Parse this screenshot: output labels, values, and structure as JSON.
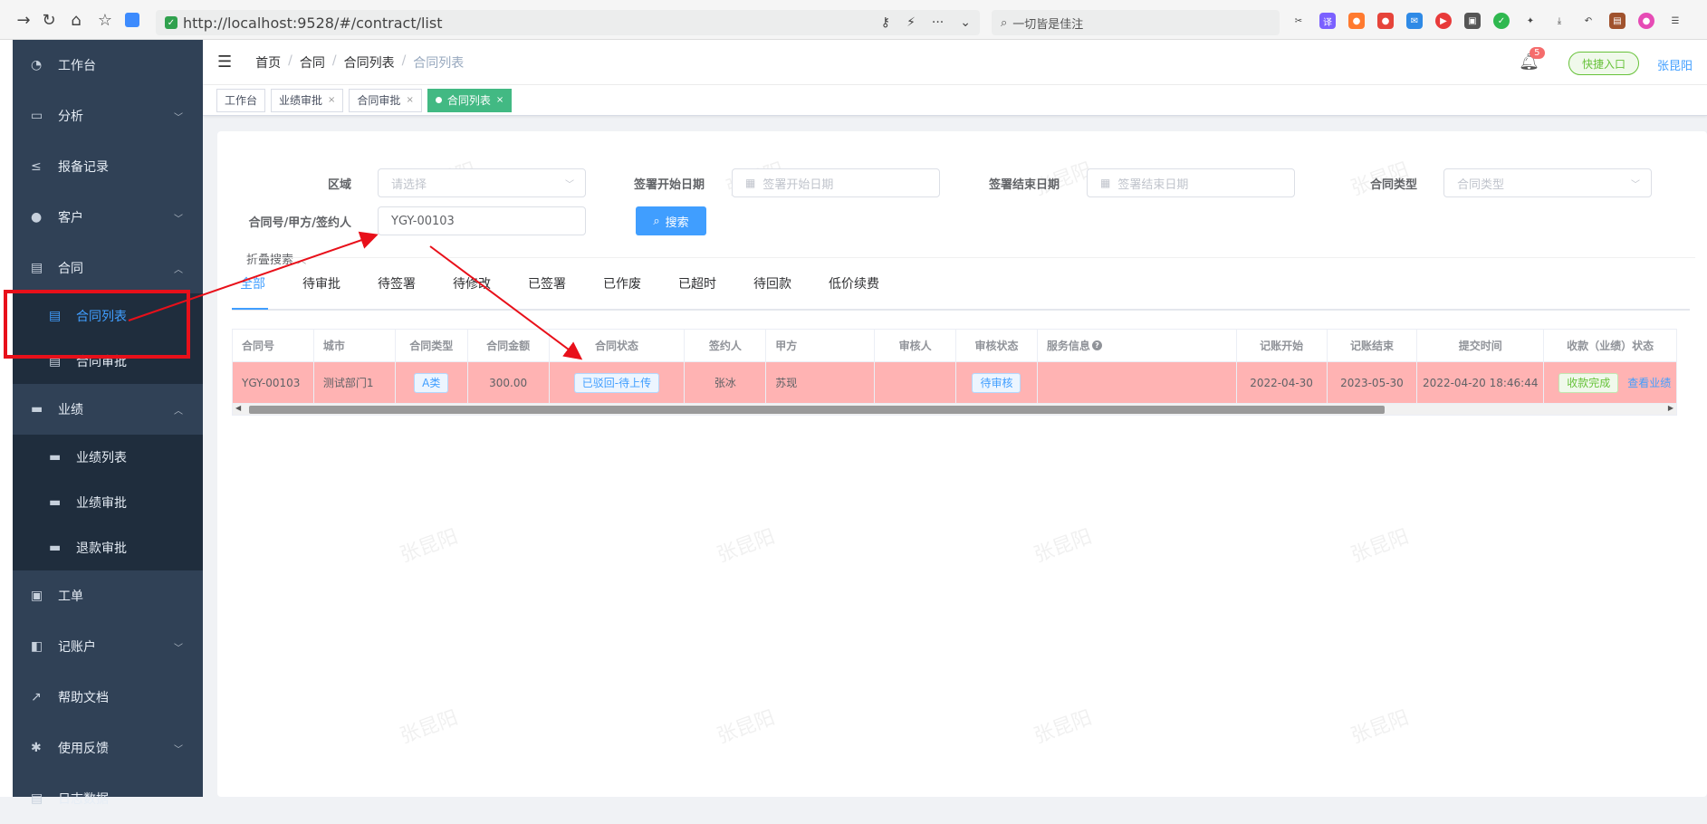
{
  "browser": {
    "url": "http://localhost:9528/#/contract/list",
    "search_placeholder": "一切皆是佳注"
  },
  "sidebar": {
    "items": [
      {
        "label": "工作台",
        "icon": "dashboard-icon"
      },
      {
        "label": "分析",
        "icon": "chart-icon"
      },
      {
        "label": "报备记录",
        "icon": "report-icon"
      },
      {
        "label": "客户",
        "icon": "user-icon"
      },
      {
        "label": "合同",
        "icon": "document-icon"
      },
      {
        "label": "合同列表",
        "icon": "document-icon"
      },
      {
        "label": "合同审批",
        "icon": "document-icon"
      },
      {
        "label": "业绩",
        "icon": "briefcase-icon"
      },
      {
        "label": "业绩列表",
        "icon": "briefcase-icon"
      },
      {
        "label": "业绩审批",
        "icon": "briefcase-icon"
      },
      {
        "label": "退款审批",
        "icon": "briefcase-icon"
      },
      {
        "label": "工单",
        "icon": "clipboard-icon"
      },
      {
        "label": "记账户",
        "icon": "book-icon"
      },
      {
        "label": "帮助文档",
        "icon": "external-link-icon"
      },
      {
        "label": "使用反馈",
        "icon": "bug-icon"
      },
      {
        "label": "日志数据",
        "icon": "document-icon"
      }
    ]
  },
  "header": {
    "breadcrumb": [
      "首页",
      "合同",
      "合同列表",
      "合同列表"
    ],
    "breadcrumb_sep": "/",
    "notification_count": "5",
    "quick_entry": "快捷入口",
    "user_name": "张昆阳"
  },
  "tags": [
    {
      "label": "工作台"
    },
    {
      "label": "业绩审批"
    },
    {
      "label": "合同审批"
    },
    {
      "label": "合同列表"
    }
  ],
  "filters": {
    "region_label": "区域",
    "region_placeholder": "请选择",
    "sign_start_label": "签署开始日期",
    "sign_start_placeholder": "签署开始日期",
    "sign_end_label": "签署结束日期",
    "sign_end_placeholder": "签署结束日期",
    "type_label": "合同类型",
    "type_placeholder": "合同类型",
    "keyword_label": "合同号/甲方/签约人",
    "keyword_value": "YGY-00103",
    "search_button": "搜索",
    "fold_label": "折叠搜索"
  },
  "status_tabs": [
    "全部",
    "待审批",
    "待签署",
    "待修改",
    "已签署",
    "已作废",
    "已超时",
    "待回款",
    "低价续费"
  ],
  "table": {
    "columns": [
      "合同号",
      "城市",
      "合同类型",
      "合同金额",
      "合同状态",
      "签约人",
      "甲方",
      "审核人",
      "审核状态",
      "服务信息",
      "记账开始",
      "记账结束",
      "提交时间",
      "收款（业绩）状态"
    ],
    "rows": [
      {
        "contract_no": "YGY-00103",
        "city": "测试部门1",
        "type": "A类",
        "amount": "300.00",
        "status": "已驳回-待上传",
        "signer": "张冰",
        "party_a": "苏现",
        "reviewer": "",
        "review_status": "待审核",
        "service_info": "",
        "start": "2022-04-30",
        "end": "2023-05-30",
        "submit_time": "2022-04-20 18:46:44",
        "payment_status": "收款完成",
        "action": "查看业绩"
      }
    ]
  },
  "watermark": "张昆阳",
  "colors": {
    "sidebar_bg": "#304156",
    "primary": "#409eff",
    "row_highlight": "#ffb3b3",
    "annotation": "#e8101a"
  }
}
